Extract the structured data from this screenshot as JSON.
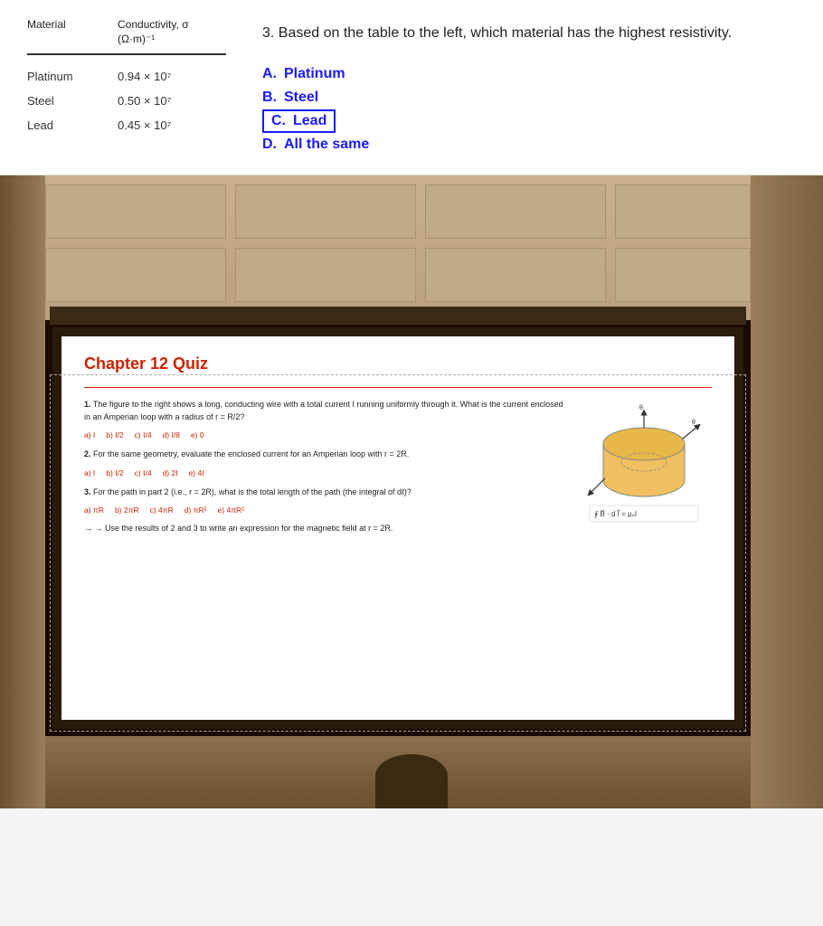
{
  "table": {
    "header_material": "Material",
    "header_conductivity": "Conductivity, σ (Ω·m)⁻¹",
    "rows": [
      {
        "material": "Platinum",
        "value": "0.94 × 10⁷"
      },
      {
        "material": "Steel",
        "value": "0.50 × 10⁷"
      },
      {
        "material": "Lead",
        "value": "0.45 × 10⁷"
      }
    ]
  },
  "question": {
    "number": "3.",
    "text": "Based on the table to the left, which material has the highest resistivity.",
    "answers": [
      {
        "letter": "A.",
        "text": "Platinum",
        "selected": false
      },
      {
        "letter": "B.",
        "text": "Steel",
        "selected": false
      },
      {
        "letter": "C.",
        "text": "Lead",
        "selected": true
      },
      {
        "letter": "D.",
        "text": "All the same",
        "selected": false
      }
    ]
  },
  "slide": {
    "title": "Chapter 12 Quiz",
    "q1": {
      "num": "1.",
      "text": "The figure to the right shows a long, conducting wire with a total current I running uniformly through it. What is the current enclosed in an Amperian loop with a radius of r = R/2?",
      "answers": [
        "a) I",
        "b) I/2",
        "c) I/4",
        "d) I/8",
        "e) 0"
      ]
    },
    "q2": {
      "num": "2.",
      "text": "For the same geometry, evaluate the enclosed current for an Amperian loop with r = 2R.",
      "answers": [
        "a) I",
        "b) I/2",
        "c) I/4",
        "d) 2I",
        "e) 4I"
      ]
    },
    "q3": {
      "num": "3.",
      "text": "For the path in part 2 (i.e., r = 2R), what is the total length of the path (the integral of dℓ)?",
      "answers": [
        "a) πR",
        "b) 2πR",
        "c) 4πR",
        "d) πR²",
        "e) 4πR²"
      ]
    },
    "arrow_text": "→ Use the results of 2 and 3 to write an expression for the magnetic field at r = 2R.",
    "formula": "∮ B⃗ · d l⃗ = μ₀I"
  }
}
